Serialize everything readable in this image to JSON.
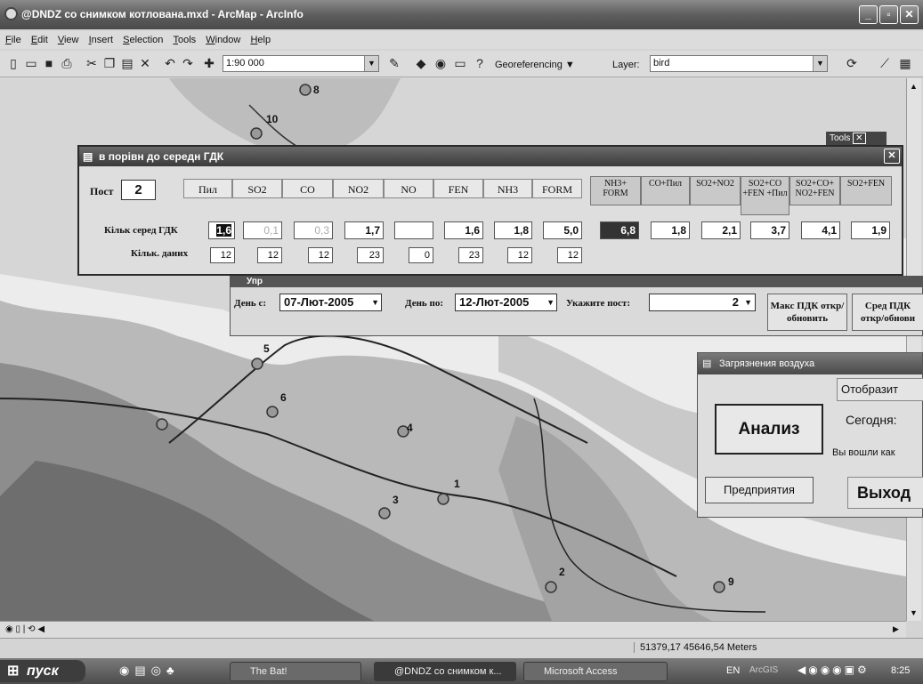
{
  "window": {
    "title": "@DNDZ со снимком котлована.mxd - ArcMap - ArcInfo",
    "controls": [
      "_",
      "▫",
      "✕"
    ]
  },
  "menu": [
    "File",
    "Edit",
    "View",
    "Insert",
    "Selection",
    "Tools",
    "Window",
    "Help"
  ],
  "toolbar": {
    "scale": "1:90 000",
    "georeferencing": "Georeferencing",
    "layer_label": "Layer:",
    "layer_value": "bird"
  },
  "map": {
    "tools_label": "Tools",
    "stations": [
      "8",
      "10",
      "5",
      "6",
      "4",
      "1",
      "3",
      "2",
      "9"
    ]
  },
  "dialog1": {
    "title": "в порівн до середн ГДК",
    "post_label": "Пост",
    "post_value": "2",
    "headers": [
      "Пил",
      "SO2",
      "CO",
      "NO2",
      "NO",
      "FEN",
      "NH3",
      "FORM"
    ],
    "combo_headers": [
      "NH3+ FORM",
      "CO+Пил",
      "SO2+NO2",
      "SO2+CO +FEN +Пил",
      "SO2+CO+ NO2+FEN",
      "SO2+FEN"
    ],
    "row1_label": "Кільк серед ГДК",
    "row1_values": [
      "1,6",
      "0,1",
      "0,3",
      "1,7",
      "",
      "1,6",
      "1,8",
      "5,0"
    ],
    "row1_combo_values": [
      "6,8",
      "1,8",
      "2,1",
      "3,7",
      "4,1",
      "1,9"
    ],
    "row2_label": "Кільк. даних",
    "row2_values": [
      "12",
      "12",
      "12",
      "23",
      "0",
      "23",
      "12",
      "12"
    ]
  },
  "dialog2": {
    "title": "Упр",
    "day_from_label": "День с:",
    "day_from": "07-Лют-2005",
    "day_to_label": "День по:",
    "day_to": "12-Лют-2005",
    "post_label": "Укажите пост:",
    "post_value": "2",
    "btn_max": "Макс ПДК откр/обновить",
    "btn_avg": "Сред ПДК откр/обнови"
  },
  "dialog3": {
    "title": "Загрязнения воздуха",
    "btn_show": "Отобразит",
    "btn_analysis": "Анализ",
    "today_label": "Сегодня:",
    "logged_as": "Вы вошли как",
    "btn_enterprises": "Предприятия",
    "btn_exit": "Выход"
  },
  "status": {
    "coords": "51379,17  45646,54 Meters"
  },
  "taskbar": {
    "start": "пуск",
    "tasks": [
      "The Bat!",
      "@DNDZ со снимком к...",
      "Microsoft Access"
    ],
    "lang": "EN",
    "tray_app": "ArcGIS",
    "time": "8:25"
  }
}
